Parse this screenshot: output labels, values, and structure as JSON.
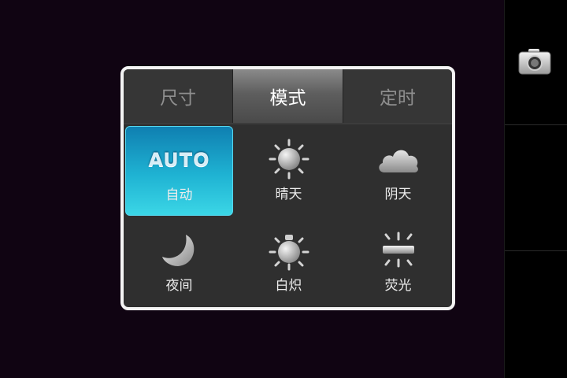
{
  "tabs": [
    {
      "label": "尺寸",
      "active": false
    },
    {
      "label": "模式",
      "active": true
    },
    {
      "label": "定时",
      "active": false
    }
  ],
  "modes": [
    {
      "label": "自动",
      "icon": "auto-icon",
      "icon_text": "AUTO",
      "selected": true
    },
    {
      "label": "晴天",
      "icon": "sun-icon",
      "selected": false
    },
    {
      "label": "阴天",
      "icon": "cloud-icon",
      "selected": false
    },
    {
      "label": "夜间",
      "icon": "moon-icon",
      "selected": false
    },
    {
      "label": "白炽",
      "icon": "incandescent-bulb-icon",
      "selected": false
    },
    {
      "label": "荧光",
      "icon": "fluorescent-icon",
      "selected": false
    }
  ],
  "side_bar": {
    "shutter_icon": "camera-icon"
  },
  "colors": {
    "accent": "#1fb3d3",
    "panel_bg": "#2f2f2f",
    "panel_border": "#f4f4f4",
    "background": "#100412"
  }
}
